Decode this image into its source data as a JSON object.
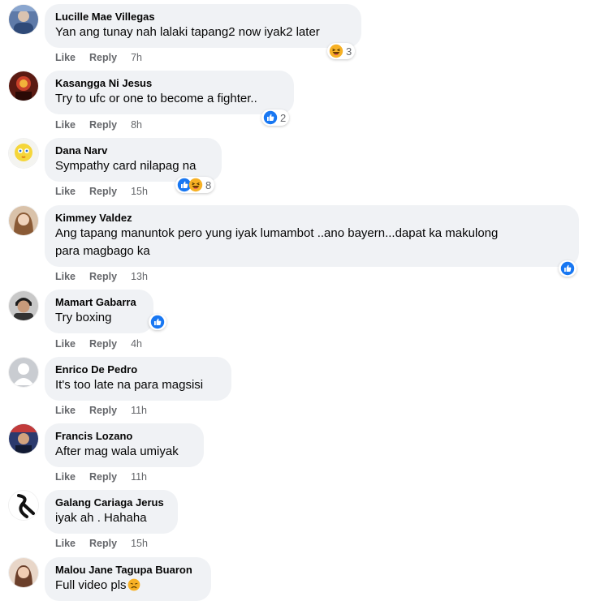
{
  "actions": {
    "like": "Like",
    "reply": "Reply"
  },
  "colors": {
    "bubble": "#f0f2f5",
    "like_blue": "#1877f2",
    "haha_yellow": "#f7b125",
    "meta_gray": "#65676b"
  },
  "comments": [
    {
      "author": "Lucille Mae Villegas",
      "text": "Yan ang tunay nah lalaki tapang2 now iyak2 later",
      "time": "7h",
      "reactions": [
        "haha-icon"
      ],
      "reaction_count": "3"
    },
    {
      "author": "Kasangga Ni Jesus",
      "text": "Try to ufc or one to become a fighter..",
      "time": "8h",
      "reactions": [
        "like-icon"
      ],
      "reaction_count": "2"
    },
    {
      "author": "Dana Narv",
      "text": "Sympathy card nilapag na",
      "time": "15h",
      "reactions": [
        "like-icon",
        "haha-icon"
      ],
      "reaction_count": "8"
    },
    {
      "author": "Kimmey Valdez",
      "text_line1": "Ang tapang manuntok pero yung iyak lumambot ..ano bayern...dapat ka makulong",
      "text_line2": "para magbago ka",
      "time": "13h",
      "reactions": [
        "like-icon"
      ],
      "reaction_count": ""
    },
    {
      "author": "Mamart Gabarra",
      "text": "Try boxing",
      "time": "4h",
      "reactions": [
        "like-icon"
      ],
      "reaction_count": ""
    },
    {
      "author": "Enrico De Pedro",
      "text": "It's too late na para magsisi",
      "time": "11h"
    },
    {
      "author": "Francis Lozano",
      "text": "After mag wala umiyak",
      "time": "11h"
    },
    {
      "author": "Galang Cariaga Jerus",
      "text": "iyak ah . Hahaha",
      "time": "15h"
    },
    {
      "author": "Malou Jane Tagupa Buaron",
      "text": "Full video pls",
      "text_emoji": "disappointed-face-emoji"
    }
  ]
}
